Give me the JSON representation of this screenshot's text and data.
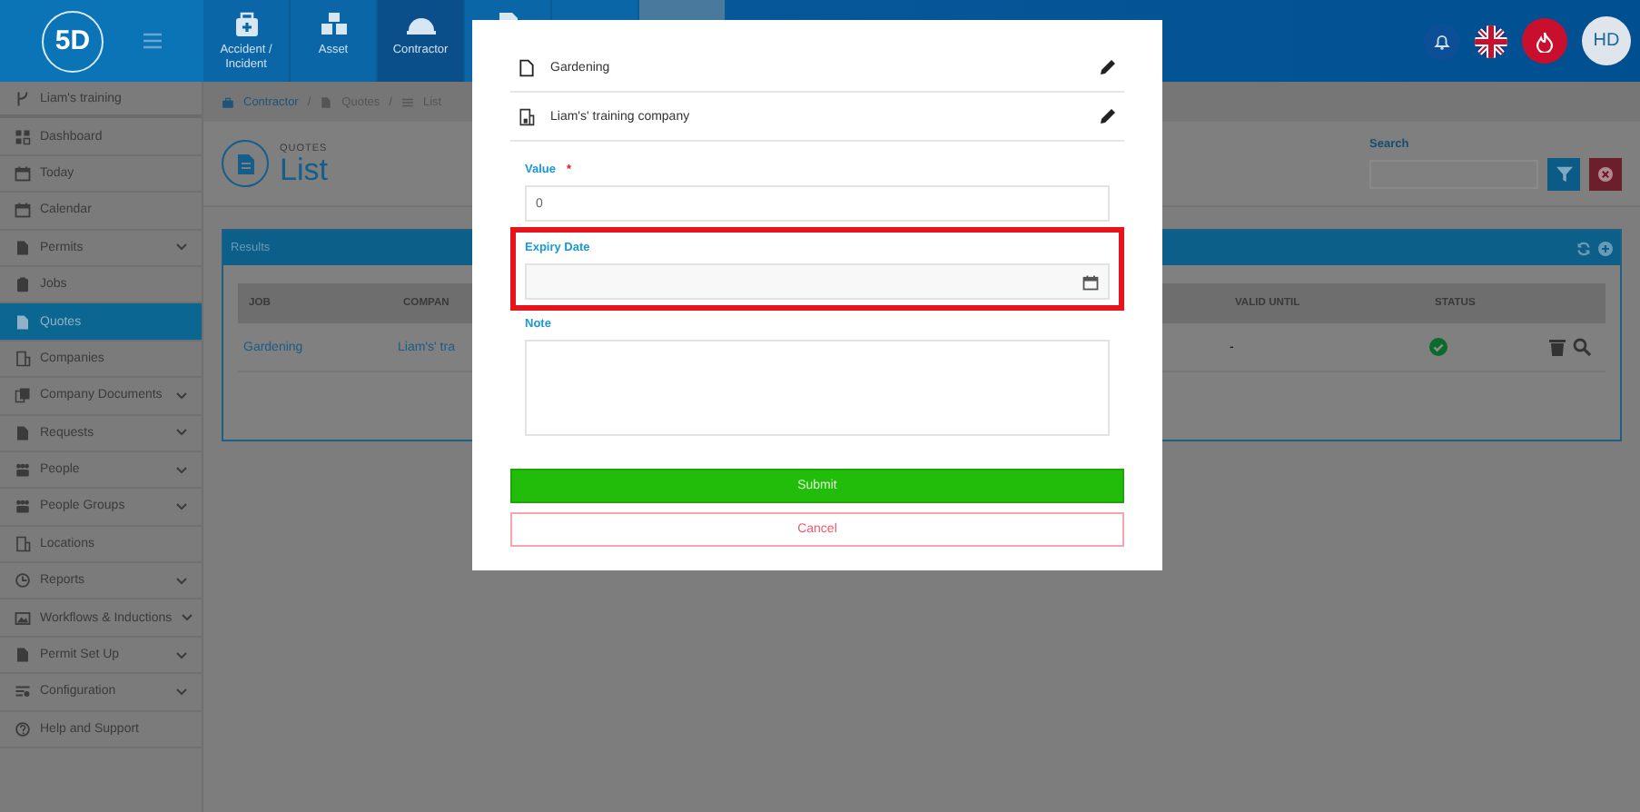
{
  "topbar": {
    "logo_text": "5D",
    "nav": [
      {
        "label": "Accident / Incident",
        "selected": false
      },
      {
        "label": "Asset",
        "selected": false
      },
      {
        "label": "Contractor",
        "selected": true
      }
    ],
    "user_initials": "HD"
  },
  "sidebar": {
    "header": "Liam's training",
    "items": [
      {
        "label": "Dashboard",
        "expandable": false,
        "selected": false
      },
      {
        "label": "Today",
        "expandable": false,
        "selected": false
      },
      {
        "label": "Calendar",
        "expandable": false,
        "selected": false
      },
      {
        "label": "Permits",
        "expandable": true,
        "selected": false
      },
      {
        "label": "Jobs",
        "expandable": false,
        "selected": false
      },
      {
        "label": "Quotes",
        "expandable": false,
        "selected": true
      },
      {
        "label": "Companies",
        "expandable": false,
        "selected": false
      },
      {
        "label": "Company Documents",
        "expandable": true,
        "selected": false
      },
      {
        "label": "Requests",
        "expandable": true,
        "selected": false
      },
      {
        "label": "People",
        "expandable": true,
        "selected": false
      },
      {
        "label": "People Groups",
        "expandable": true,
        "selected": false
      },
      {
        "label": "Locations",
        "expandable": false,
        "selected": false
      },
      {
        "label": "Reports",
        "expandable": true,
        "selected": false
      },
      {
        "label": "Workflows & Inductions",
        "expandable": true,
        "selected": false
      },
      {
        "label": "Permit Set Up",
        "expandable": true,
        "selected": false
      },
      {
        "label": "Configuration",
        "expandable": true,
        "selected": false
      },
      {
        "label": "Help and Support",
        "expandable": false,
        "selected": false
      }
    ]
  },
  "breadcrumb": {
    "separator": "/",
    "items": [
      "Contractor",
      "Quotes",
      "List"
    ]
  },
  "page": {
    "section": "QUOTES",
    "title": "List",
    "search_label": "Search"
  },
  "results": {
    "title": "Results",
    "columns": [
      "JOB",
      "COMPAN",
      "VALID UNTIL",
      "STATUS"
    ],
    "rows": [
      {
        "job": "Gardening",
        "company": "Liam's' tra",
        "valid_until": "-",
        "approved": true
      }
    ]
  },
  "modal": {
    "items": [
      {
        "text": "Gardening"
      },
      {
        "text": "Liam's' training company"
      }
    ],
    "fields": [
      {
        "kind": "text",
        "label": "Value",
        "required_mark": "*",
        "value": "0",
        "highlighted": false
      },
      {
        "kind": "date",
        "label": "Expiry Date",
        "highlighted": true
      },
      {
        "kind": "textarea",
        "label": "Note",
        "highlighted": false
      }
    ],
    "buttons": [
      {
        "kind": "primary",
        "label": "Submit"
      },
      {
        "kind": "cancel",
        "label": "Cancel"
      }
    ]
  }
}
